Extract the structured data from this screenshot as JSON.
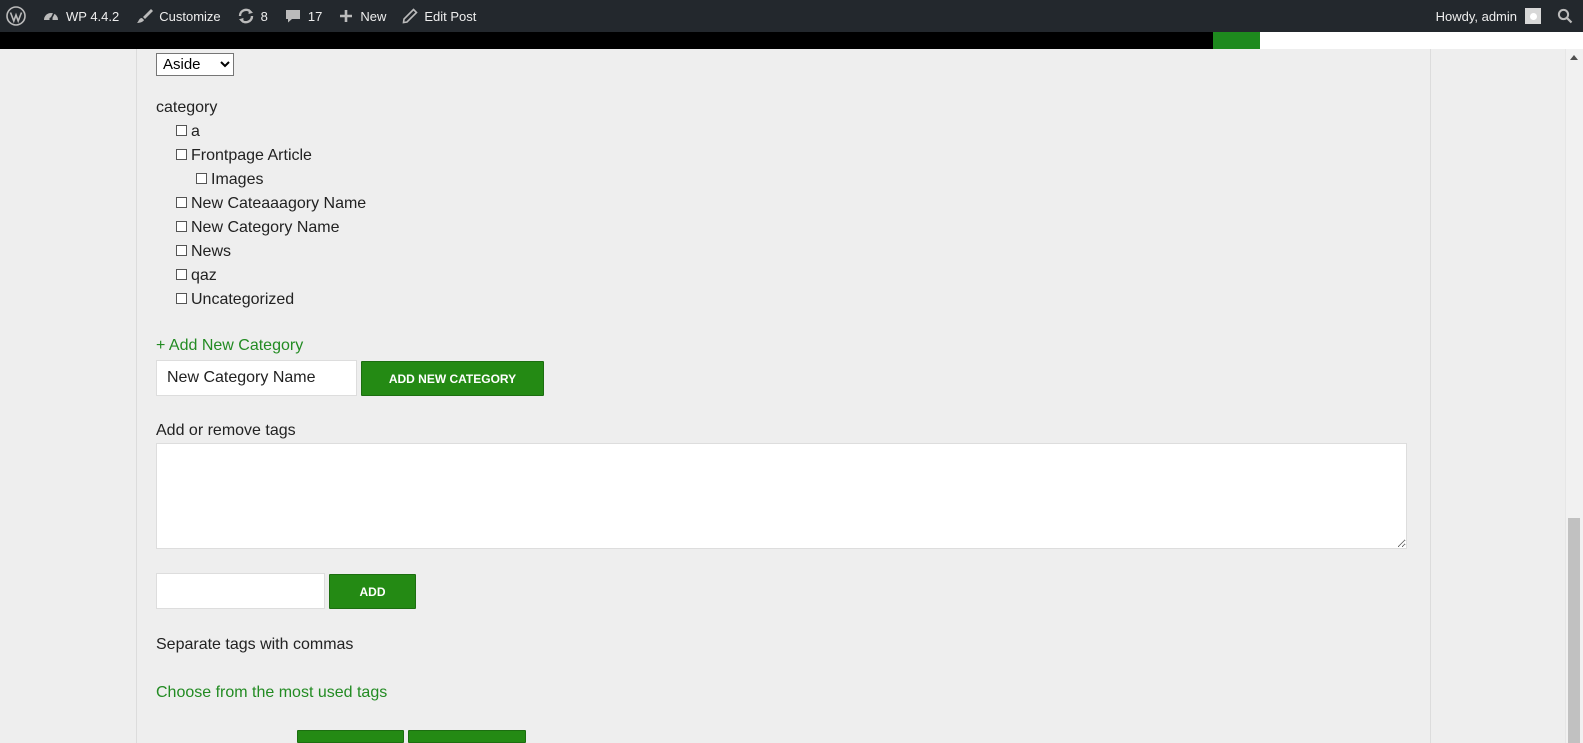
{
  "adminbar": {
    "site_name": "WP 4.4.2",
    "customize": "Customize",
    "updates_count": "8",
    "comments_count": "17",
    "new_label": "New",
    "edit_post": "Edit Post",
    "howdy": "Howdy, admin",
    "icons": [
      "wordpress-logo-icon",
      "dashboard-icon",
      "brush-icon",
      "refresh-icon",
      "comment-icon",
      "plus-icon",
      "pencil-icon",
      "search-icon"
    ]
  },
  "form": {
    "format_select": {
      "selected": "Aside"
    },
    "category_label": "category",
    "categories": [
      {
        "label": "a",
        "level": 0
      },
      {
        "label": "Frontpage Article",
        "level": 0
      },
      {
        "label": "Images",
        "level": 1
      },
      {
        "label": "New Cateaaagory Name",
        "level": 0
      },
      {
        "label": "New Category Name",
        "level": 0
      },
      {
        "label": "News",
        "level": 0
      },
      {
        "label": "qaz",
        "level": 0
      },
      {
        "label": "Uncategorized",
        "level": 0
      }
    ],
    "add_category_link": "+ Add New Category",
    "new_category_input_value": "New Category Name",
    "add_category_button": "ADD NEW CATEGORY",
    "tags_label": "Add or remove tags",
    "tags_textarea_value": "",
    "tag_input_value": "",
    "add_tag_button": "ADD",
    "separate_hint": "Separate tags with commas",
    "choose_tags_link": "Choose from the most used tags"
  },
  "colors": {
    "adminbar_bg": "#23282d",
    "accent_green": "#248a14",
    "link_green": "#228b22",
    "page_bg": "#eeeeee"
  }
}
